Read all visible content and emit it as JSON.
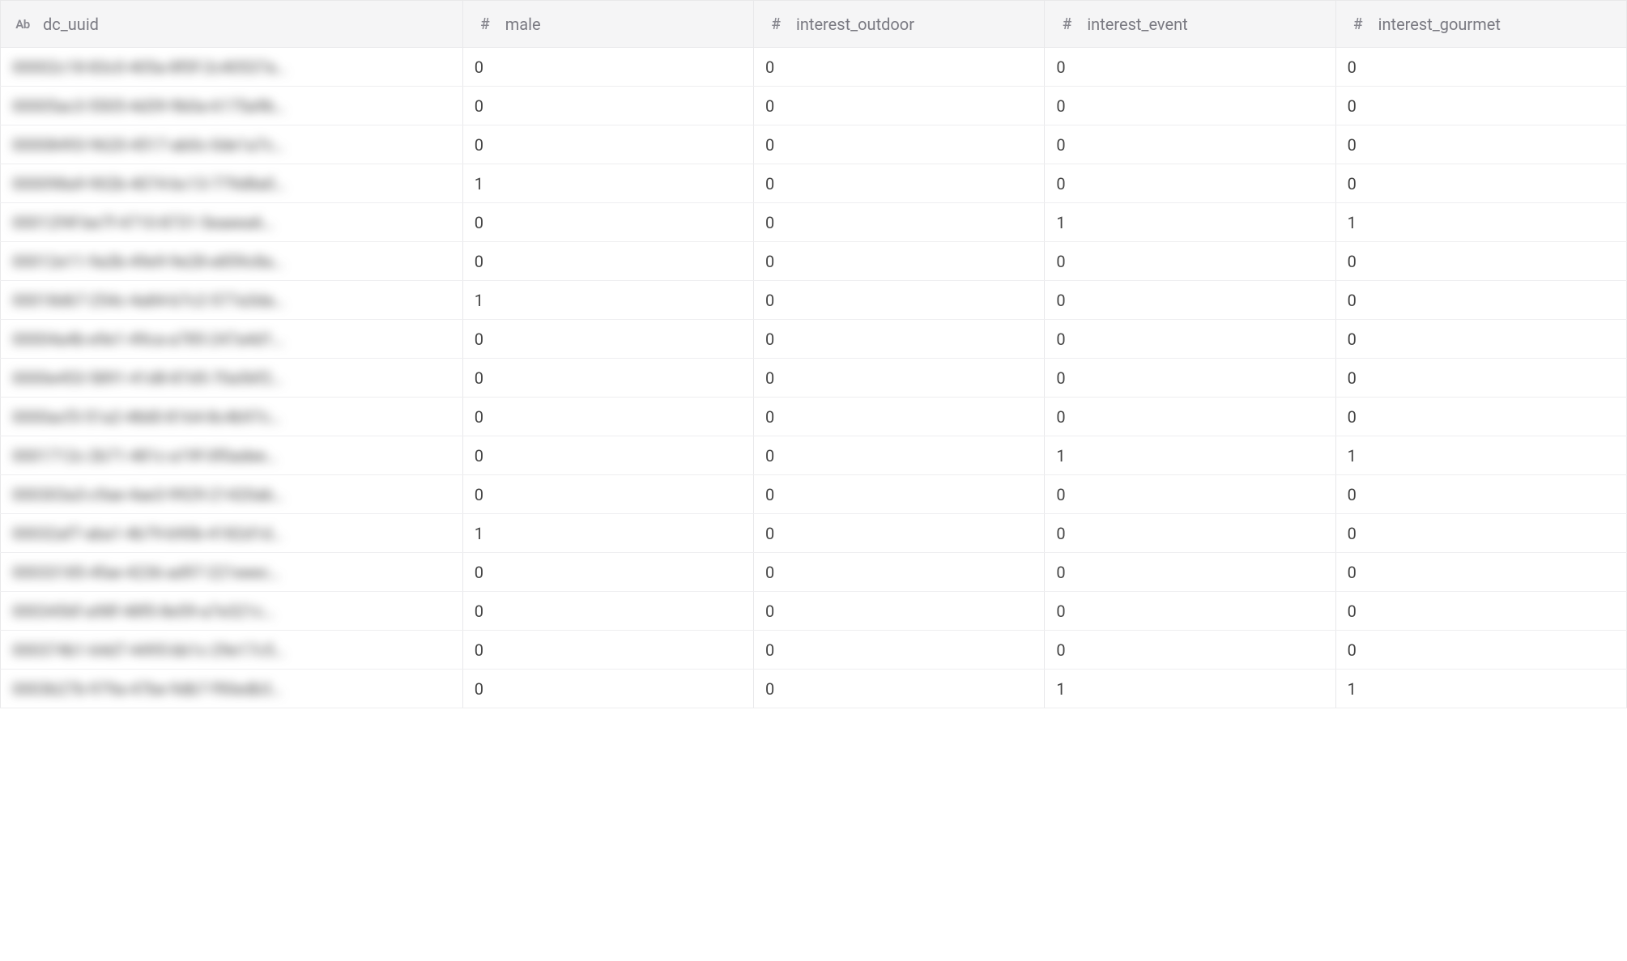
{
  "columns": [
    {
      "type_label": "Ab",
      "label": "dc_uuid",
      "type": "text"
    },
    {
      "type_label": "#",
      "label": "male",
      "type": "number"
    },
    {
      "type_label": "#",
      "label": "interest_outdoor",
      "type": "number"
    },
    {
      "type_label": "#",
      "label": "interest_event",
      "type": "number"
    },
    {
      "type_label": "#",
      "label": "interest_gourmet",
      "type": "number"
    }
  ],
  "rows": [
    {
      "dc_uuid": "00002c18-83c0-405a-8f0f-2c40537a…",
      "male": "0",
      "interest_outdoor": "0",
      "interest_event": "0",
      "interest_gourmet": "0"
    },
    {
      "dc_uuid": "00005ac3-5505-4d39-9b0a-6175a9b…",
      "male": "0",
      "interest_outdoor": "0",
      "interest_event": "0",
      "interest_gourmet": "0"
    },
    {
      "dc_uuid": "00008493-9620-4517-ab0c-0de1a7c…",
      "male": "0",
      "interest_outdoor": "0",
      "interest_event": "0",
      "interest_gourmet": "0"
    },
    {
      "dc_uuid": "000098a9-902b-4074-bc13-779d8a0…",
      "male": "1",
      "interest_outdoor": "0",
      "interest_event": "0",
      "interest_gourmet": "0"
    },
    {
      "dc_uuid": "00012f4f-be7f-4710-8731-5eaeea6…",
      "male": "0",
      "interest_outdoor": "0",
      "interest_event": "1",
      "interest_gourmet": "1"
    },
    {
      "dc_uuid": "00012e11-9a3b-49e9-9e28-e859c8a…",
      "male": "0",
      "interest_outdoor": "0",
      "interest_event": "0",
      "interest_gourmet": "0"
    },
    {
      "dc_uuid": "00018d67-254c-4a84-b7c2-577a3da…",
      "male": "1",
      "interest_outdoor": "0",
      "interest_event": "0",
      "interest_gourmet": "0"
    },
    {
      "dc_uuid": "00004a4b-e9e1-49ca-a785-247a4d1…",
      "male": "0",
      "interest_outdoor": "0",
      "interest_event": "0",
      "interest_gourmet": "0"
    },
    {
      "dc_uuid": "0000e453-5891-41d8-87d5-70a56f2…",
      "male": "0",
      "interest_outdoor": "0",
      "interest_event": "0",
      "interest_gourmet": "0"
    },
    {
      "dc_uuid": "0000acf3-51a2-48d0-8164-8c4b97c…",
      "male": "0",
      "interest_outdoor": "0",
      "interest_event": "0",
      "interest_gourmet": "0"
    },
    {
      "dc_uuid": "0001712c-2b71-481c-a19f-0f0adee…",
      "male": "0",
      "interest_outdoor": "0",
      "interest_event": "1",
      "interest_gourmet": "1"
    },
    {
      "dc_uuid": "000303a3-c9ae-4ae3-9929-21420ab…",
      "male": "0",
      "interest_outdoor": "0",
      "interest_event": "0",
      "interest_gourmet": "0"
    },
    {
      "dc_uuid": "00032af7-aba1-4b79-b90b-4182d1d…",
      "male": "1",
      "interest_outdoor": "0",
      "interest_event": "0",
      "interest_gourmet": "0"
    },
    {
      "dc_uuid": "00033185-4fae-4236-ad97-221eeec…",
      "male": "0",
      "interest_outdoor": "0",
      "interest_event": "0",
      "interest_gourmet": "0"
    },
    {
      "dc_uuid": "0003456f-a98f-48f0-8e59-a7e321c…",
      "male": "0",
      "interest_outdoor": "0",
      "interest_event": "0",
      "interest_gourmet": "0"
    },
    {
      "dc_uuid": "000374b1-64d7-4495-bb1c-29e17c5…",
      "male": "0",
      "interest_outdoor": "0",
      "interest_event": "0",
      "interest_gourmet": "0"
    },
    {
      "dc_uuid": "0003b27b-979a-47be-9db7-f90edb3…",
      "male": "0",
      "interest_outdoor": "0",
      "interest_event": "1",
      "interest_gourmet": "1"
    }
  ]
}
